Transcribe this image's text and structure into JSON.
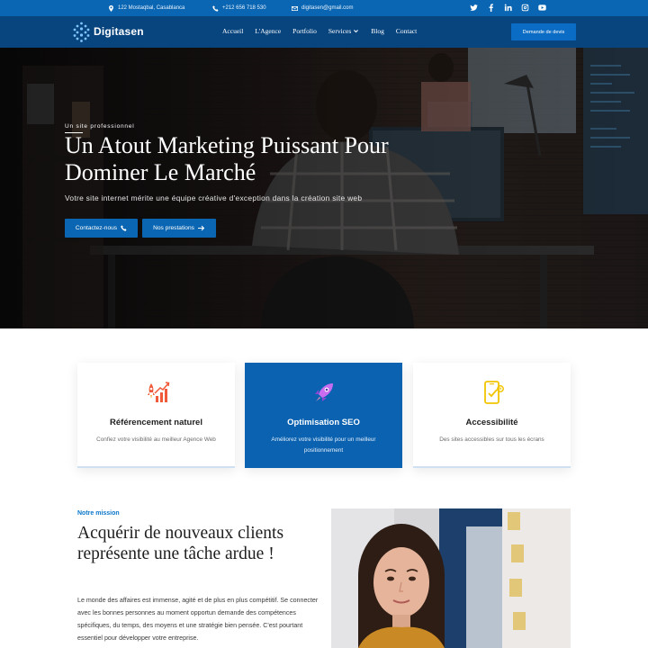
{
  "topbar": {
    "address": "122 Mostaqbal, Casablanca",
    "phone": "+212 656 718 530",
    "email": "digitasen@gmail.com",
    "socials": [
      "twitter-icon",
      "facebook-icon",
      "linkedin-icon",
      "instagram-icon",
      "youtube-icon"
    ]
  },
  "nav": {
    "logo": "Digitasen",
    "items": [
      "Accueil",
      "L'Agence",
      "Portfolio",
      "Services",
      "Blog",
      "Contact"
    ],
    "cta": "Demande de devis"
  },
  "hero": {
    "kicker": "Un site professionnel",
    "title": "Un Atout Marketing Puissant Pour Dominer Le Marché",
    "subtitle": "Votre site internet mérite une équipe créative d'exception dans la création site web",
    "btn_contact": "Contactez-nous",
    "btn_services": "Nos prestations"
  },
  "features": [
    {
      "title": "Référencement naturel",
      "desc": "Confiez votre visibilité au meilleur Agence Web",
      "icon": "growth-rocket-icon"
    },
    {
      "title": "Optimisation SEO",
      "desc": "Améliorez votre visibilité pour un meilleur positionnement",
      "icon": "rocket-icon"
    },
    {
      "title": "Accessibilité",
      "desc": "Des sites accessibles sur tous les écrans",
      "icon": "phone-touch-icon"
    }
  ],
  "mission": {
    "kicker": "Notre mission",
    "title": "Acquérir de nouveaux clients représente une tâche ardue !",
    "text": "Le monde des affaires est immense, agité et de plus en plus compétitif. Se connecter avec les bonnes personnes au moment opportun demande des compétences spécifiques, du temps, des moyens et une stratégie bien pensée. C'est pourtant essentiel pour développer votre entreprise."
  },
  "colors": {
    "topbar": "#0a66b2",
    "navbar": "#08457f",
    "accent": "#0a62b1",
    "kicker": "#0a76c9"
  }
}
